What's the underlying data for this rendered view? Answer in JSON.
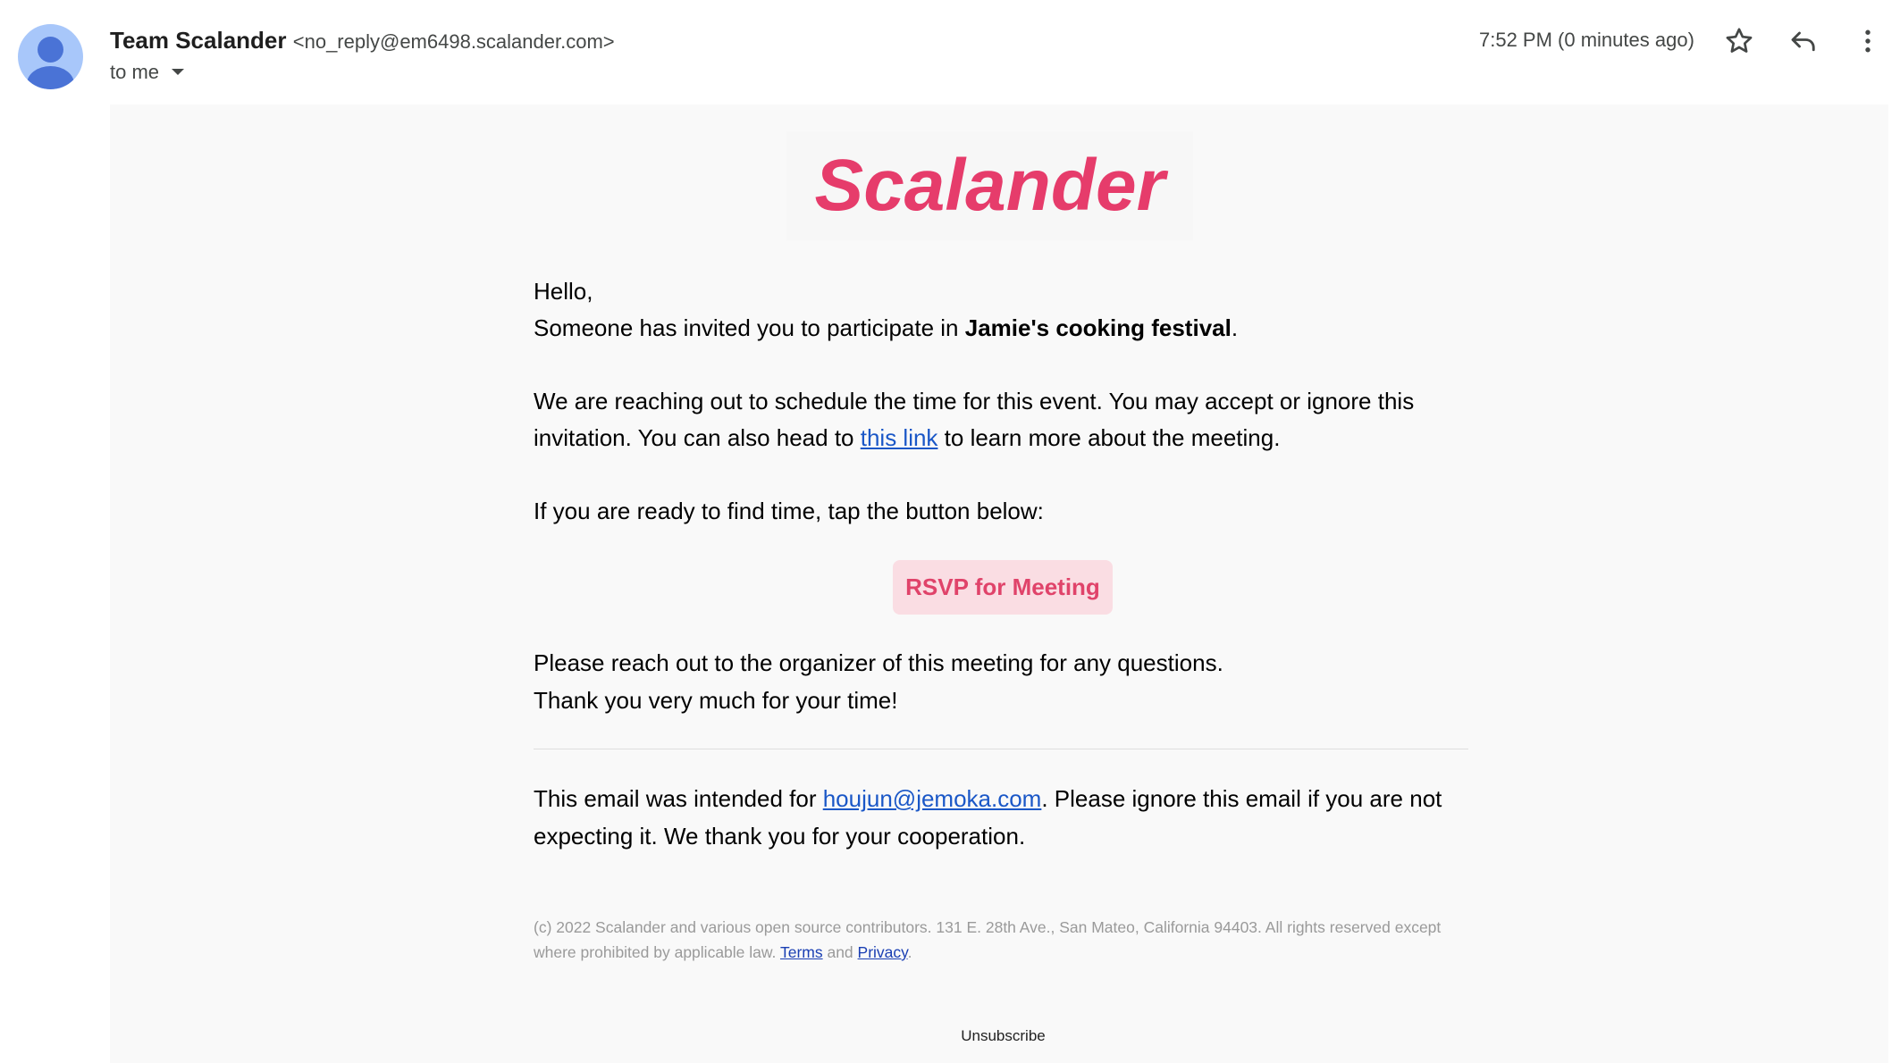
{
  "header": {
    "sender_name": "Team Scalander",
    "sender_email": "<no_reply@em6498.scalander.com>",
    "to_label": "to me",
    "timestamp": "7:52 PM (0 minutes ago)"
  },
  "icons": {
    "avatar": "avatar-icon",
    "star": "star-icon",
    "reply": "reply-icon",
    "more": "more-vert-icon",
    "caret": "caret-down-icon"
  },
  "email": {
    "logo_text": "Scalander",
    "greeting": "Hello,",
    "invite_prefix": "Someone has invited you to participate in ",
    "event_name": "Jamie's cooking festival",
    "invite_suffix": ".",
    "schedule_text": "We are reaching out to schedule the time for this event. You may accept or ignore this invitation. You can also head to ",
    "schedule_link": "this link",
    "schedule_suffix": " to learn more about the meeting.",
    "ready_text": "If you are ready to find time, tap the button below:",
    "rsvp_button": "RSVP for Meeting",
    "reach_out": "Please reach out to the organizer of this meeting for any questions.",
    "thanks": "Thank you very much for your time!",
    "intended_prefix": "This email was intended for ",
    "intended_email": "houjun@jemoka.com",
    "intended_suffix": ". Please ignore this email if you are not expecting it. We thank you for your cooperation.",
    "legal_text": "(c) 2022 Scalander and various open source contributors. 131 E. 28th Ave., San Mateo, California 94403. All rights reserved except where prohibited by applicable law. ",
    "terms_link": "Terms",
    "and_text": " and ",
    "privacy_link": "Privacy",
    "legal_end": ".",
    "unsubscribe": "Unsubscribe"
  },
  "colors": {
    "brand": "#e63c6b",
    "button_bg": "#fadde3",
    "link": "#1a57c7"
  }
}
